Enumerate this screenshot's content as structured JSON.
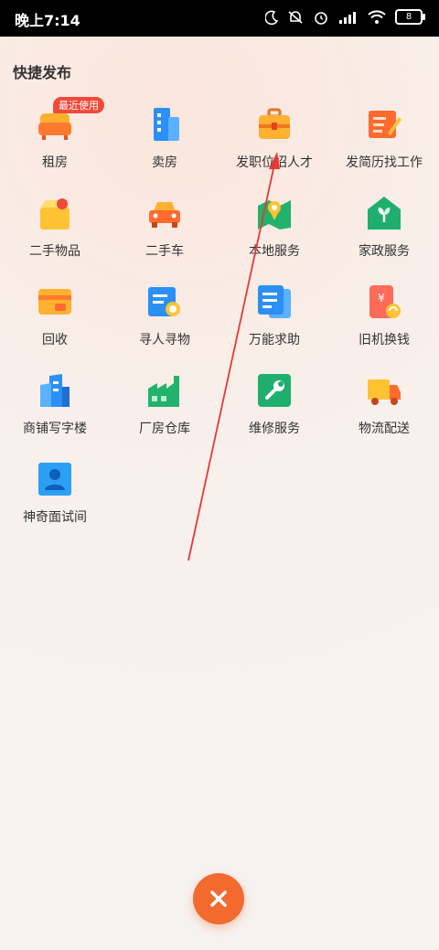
{
  "status_bar": {
    "time": "晚上7:14",
    "battery": "8"
  },
  "section_title": "快捷发布",
  "items": [
    {
      "label": "租房",
      "icon": "rent-sofa-icon",
      "badge": "最近使用"
    },
    {
      "label": "卖房",
      "icon": "sell-building-icon"
    },
    {
      "label": "发职位招人才",
      "icon": "job-briefcase-icon"
    },
    {
      "label": "发简历找工作",
      "icon": "resume-document-icon"
    },
    {
      "label": "二手物品",
      "icon": "secondhand-box-icon"
    },
    {
      "label": "二手车",
      "icon": "used-car-icon"
    },
    {
      "label": "本地服务",
      "icon": "local-service-map-icon"
    },
    {
      "label": "家政服务",
      "icon": "housekeeping-house-icon"
    },
    {
      "label": "回收",
      "icon": "recycle-card-icon"
    },
    {
      "label": "寻人寻物",
      "icon": "search-person-item-icon"
    },
    {
      "label": "万能求助",
      "icon": "help-document-icon"
    },
    {
      "label": "旧机换钱",
      "icon": "old-phone-cash-icon"
    },
    {
      "label": "商铺写字楼",
      "icon": "office-building-icon"
    },
    {
      "label": "厂房仓库",
      "icon": "factory-warehouse-icon"
    },
    {
      "label": "维修服务",
      "icon": "repair-wrench-icon"
    },
    {
      "label": "物流配送",
      "icon": "logistics-truck-icon"
    },
    {
      "label": "神奇面试间",
      "icon": "interview-person-icon"
    }
  ],
  "colors": {
    "accent": "#f26a2e",
    "badge": "#f0493a",
    "annotation_arrow": "#e53935"
  },
  "close_button": {
    "icon": "close-icon"
  }
}
